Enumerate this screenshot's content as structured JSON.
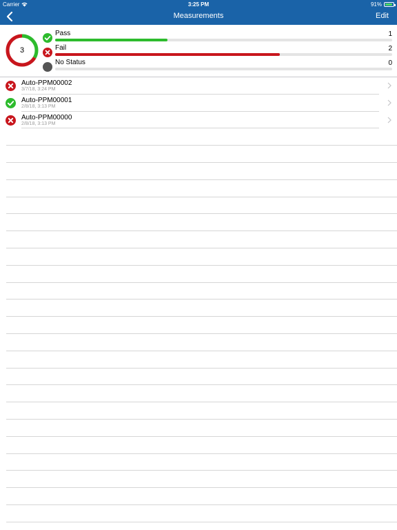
{
  "status_bar": {
    "carrier": "Carrier",
    "time": "3:25 PM",
    "battery": "91%",
    "battery_level": 0.91
  },
  "nav": {
    "title": "Measurements",
    "edit_label": "Edit",
    "back_icon": "chevron-left-icon"
  },
  "summary": {
    "total": "3",
    "rows": [
      {
        "label": "Pass",
        "count": "1",
        "icon": "check-circle-icon",
        "color": "#2dbb2d",
        "fraction": 0.333
      },
      {
        "label": "Fail",
        "count": "2",
        "icon": "x-circle-icon",
        "color": "#c8161d",
        "fraction": 0.667
      },
      {
        "label": "No Status",
        "count": "0",
        "icon": "gray-dot-icon",
        "color": "#555555",
        "fraction": 0
      }
    ]
  },
  "measurements": [
    {
      "name": "Auto-PPM00002",
      "date": "3/7/18, 3:24 PM",
      "status": "fail"
    },
    {
      "name": "Auto-PPM00001",
      "date": "2/8/18, 3:13 PM",
      "status": "pass"
    },
    {
      "name": "Auto-PPM00000",
      "date": "2/8/18, 3:13 PM",
      "status": "fail"
    }
  ],
  "colors": {
    "nav_bg": "#1a63a8",
    "pass": "#2dbb2d",
    "fail": "#c8161d",
    "neutral": "#555555"
  }
}
